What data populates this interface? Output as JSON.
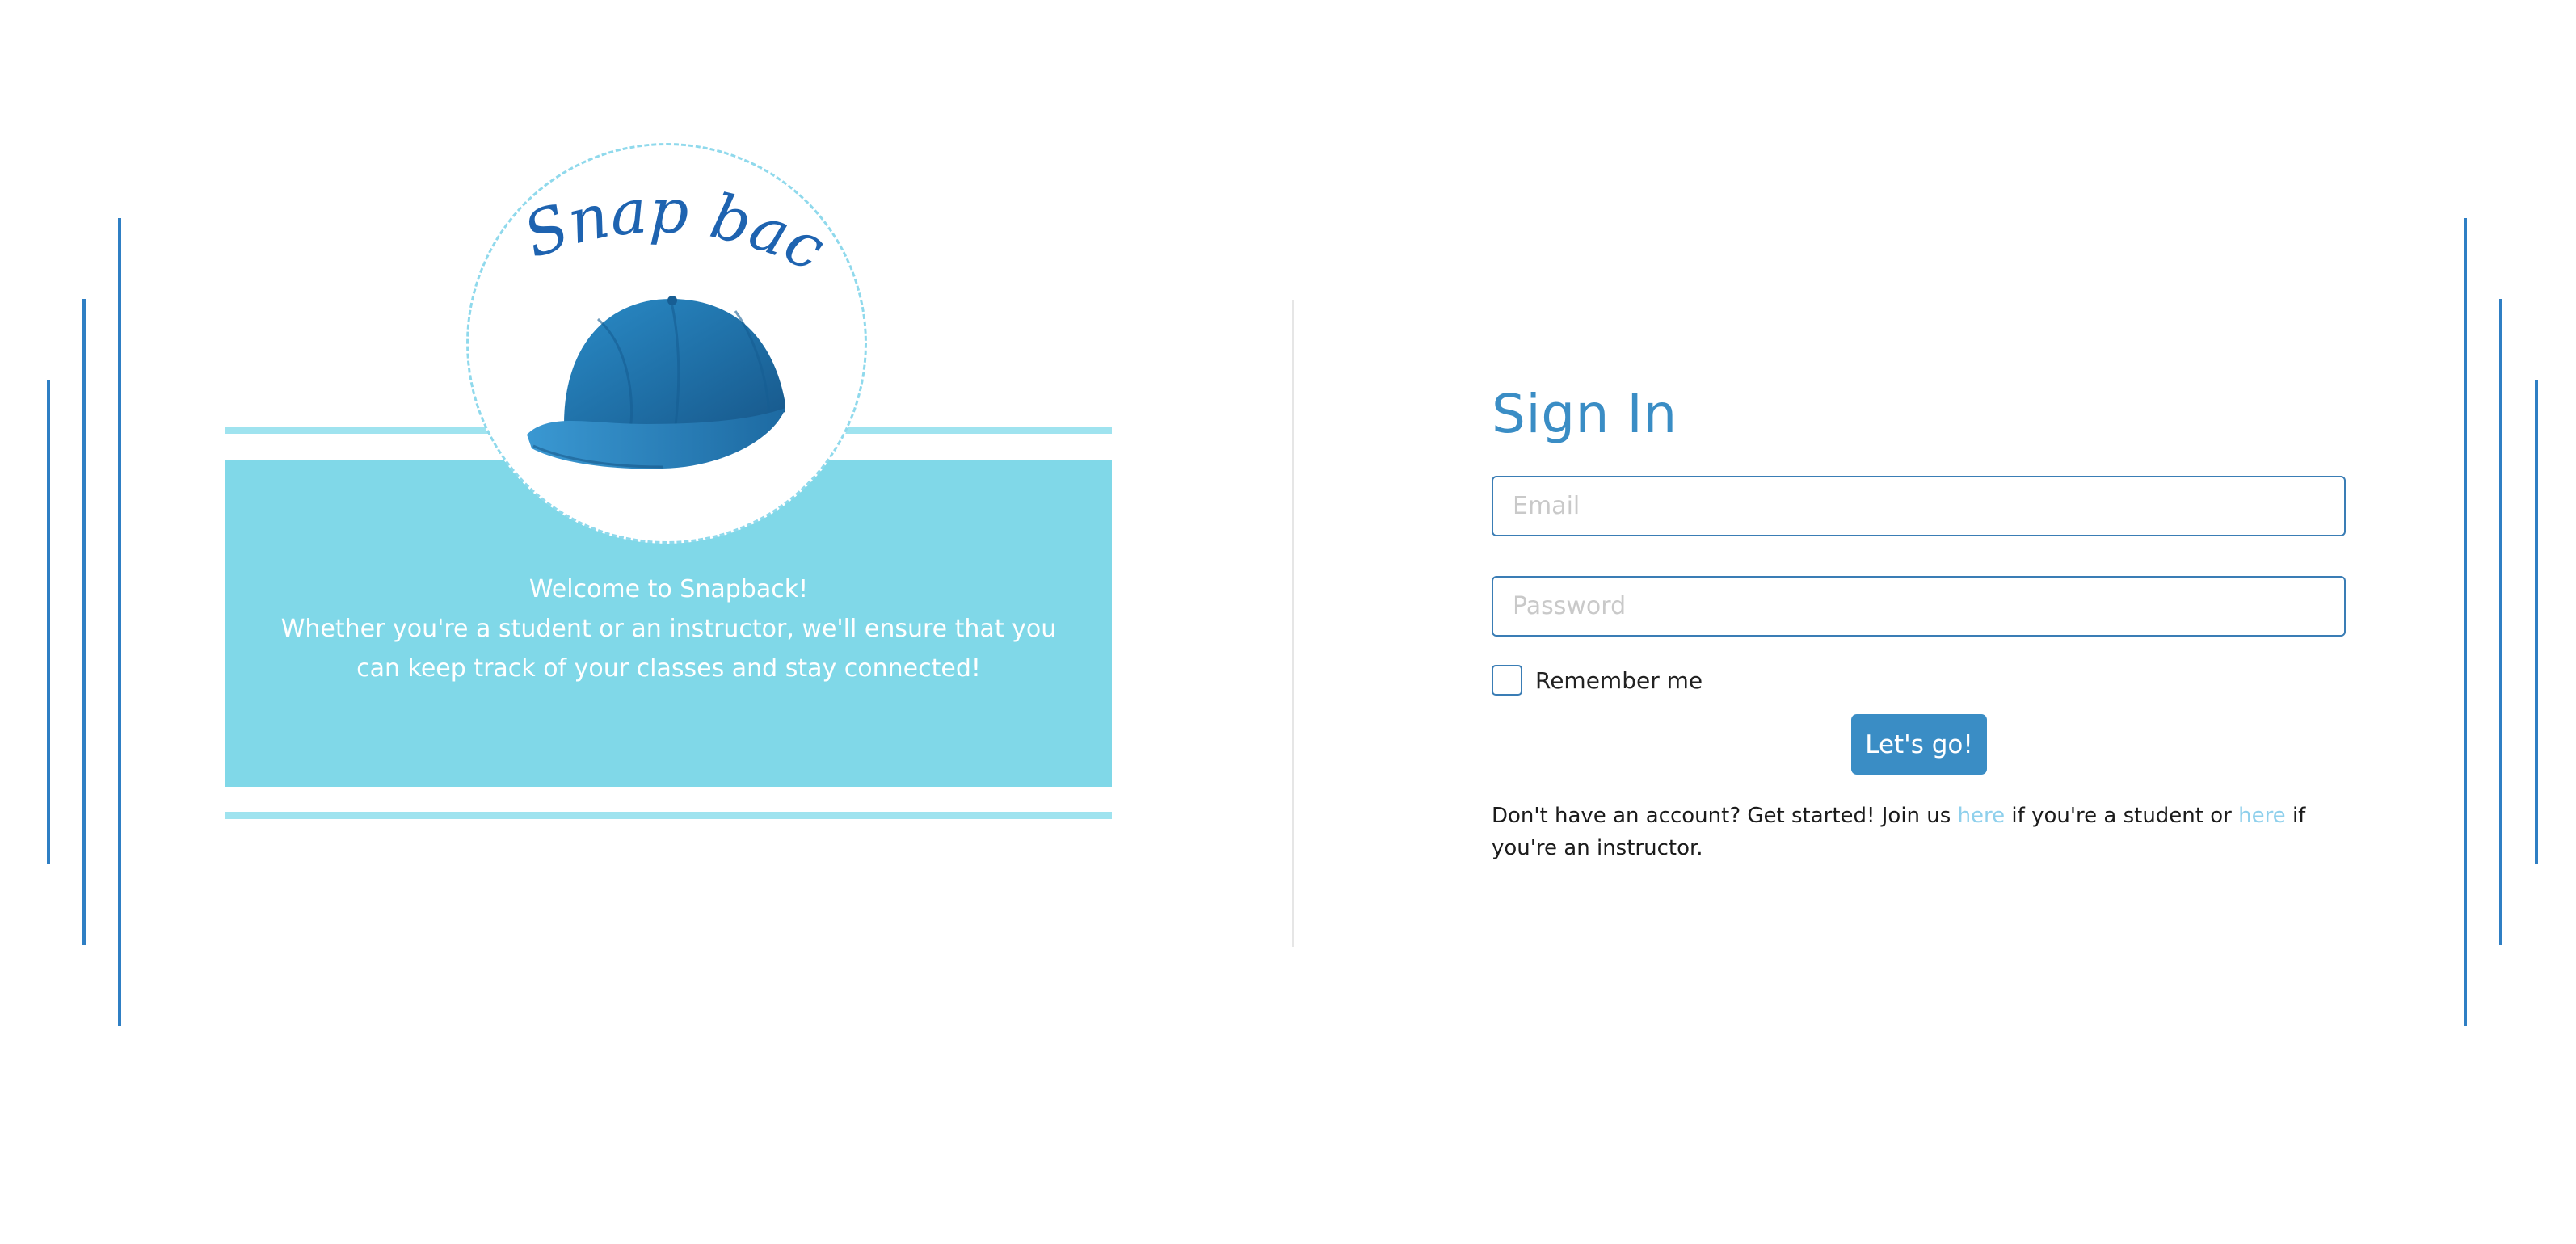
{
  "logo": {
    "text": "Snap back",
    "hat_color": "#1f6fa6"
  },
  "welcome": {
    "line1": "Welcome to Snapback!",
    "line2": "Whether you're a student or an instructor, we'll ensure that you can keep track of your classes and stay connected!"
  },
  "signin": {
    "title": "Sign In",
    "email_placeholder": "Email",
    "password_placeholder": "Password",
    "remember_label": "Remember me",
    "submit_label": "Let's go!",
    "signup_prefix": "Don't have an account? Get started! Join us ",
    "student_link": "here",
    "signup_middle": " if you're a student or ",
    "instructor_link": "here",
    "signup_suffix": " if you're an instructor."
  },
  "colors": {
    "accent": "#3a8dc5",
    "banner": "#80d8e8",
    "stripe": "#9fe3ef",
    "lines": "#2f7fc4",
    "link": "#8fd0ec"
  }
}
